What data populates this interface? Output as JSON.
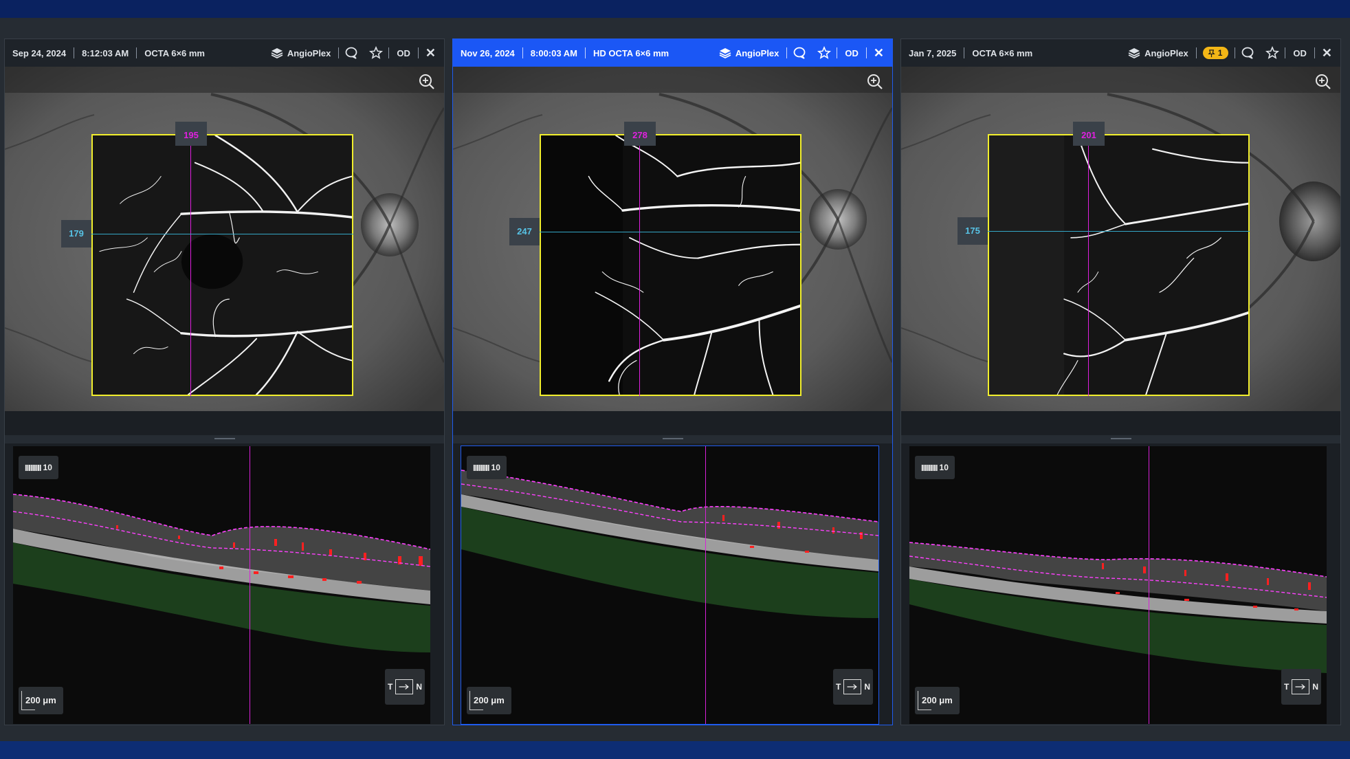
{
  "panels": [
    {
      "date": "Sep 24, 2024",
      "time": "8:12:03 AM",
      "scan": "OCTA 6×6 mm",
      "module": "AngioPlex",
      "eye": "OD",
      "pin_count": "",
      "slice_x": "195",
      "slice_y": "179",
      "zoom_ticks": "IIIIIIIII",
      "zoom": "10",
      "scale": "200 μm",
      "orient_left": "T",
      "orient_right": "N",
      "active": false
    },
    {
      "date": "Nov 26, 2024",
      "time": "8:00:03 AM",
      "scan": "HD OCTA 6×6 mm",
      "module": "AngioPlex",
      "eye": "OD",
      "pin_count": "",
      "slice_x": "278",
      "slice_y": "247",
      "zoom_ticks": "IIIIIIIII",
      "zoom": "10",
      "scale": "200 μm",
      "orient_left": "T",
      "orient_right": "N",
      "active": true
    },
    {
      "date": "Jan 7, 2025",
      "time": "",
      "scan": "OCTA 6×6 mm",
      "module": "AngioPlex",
      "eye": "OD",
      "pin_count": "1",
      "slice_x": "201",
      "slice_y": "175",
      "zoom_ticks": "IIIIIIIII",
      "zoom": "10",
      "scale": "200 μm",
      "orient_left": "T",
      "orient_right": "N",
      "active": false
    }
  ],
  "icons": {
    "module": "stack-layers-icon",
    "comment": "comment-icon",
    "favorite": "star-icon",
    "close": "close-icon",
    "search": "zoom-search-icon",
    "pin": "pin-icon"
  },
  "colors": {
    "frame_highlight": "#1b57f5",
    "octa_border": "#f2ef2c",
    "slice_line": "#e020e0",
    "horizontal_line": "#34a8c8",
    "pin_badge": "#f3b616"
  }
}
